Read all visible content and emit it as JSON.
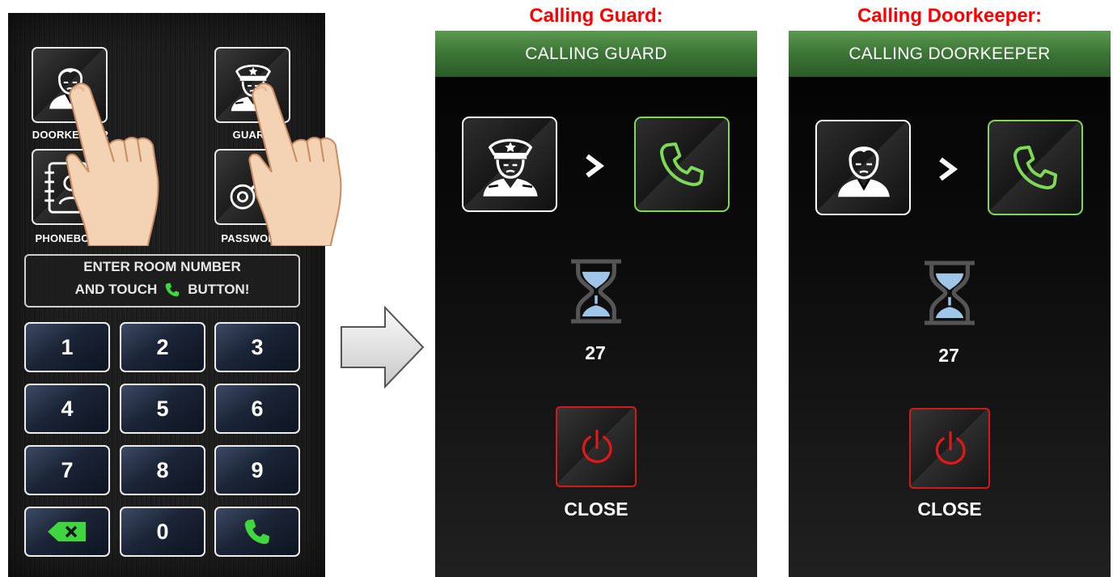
{
  "keypad_screen": {
    "tiles": {
      "doorkeeper": "DOORKEEPER",
      "guard": "GUARD",
      "phonebook": "PHONEBOOK",
      "password": "PASSWORD"
    },
    "instruction": {
      "line1": "ENTER ROOM NUMBER",
      "line2_before": "AND TOUCH",
      "line2_after": "BUTTON!"
    },
    "keys": [
      "1",
      "2",
      "3",
      "4",
      "5",
      "6",
      "7",
      "8",
      "9",
      "0"
    ],
    "icons": {
      "delete": "backspace-icon",
      "call": "phone-icon",
      "hand": "pointing-hand-icon"
    },
    "colors": {
      "accent_green": "#3fd63f",
      "key_border": "#eeeeee"
    }
  },
  "guard_call": {
    "panel_title": "Calling Guard:",
    "header": "CALLING GUARD",
    "countdown": "27",
    "close_label": "CLOSE",
    "icons": {
      "caller": "guard-icon",
      "call": "phone-icon",
      "timer": "hourglass-icon",
      "close": "power-icon"
    }
  },
  "doorkeeper_call": {
    "panel_title": "Calling Doorkeeper:",
    "header": "CALLING DOORKEEPER",
    "countdown": "27",
    "close_label": "CLOSE",
    "icons": {
      "caller": "doorkeeper-icon",
      "call": "phone-icon",
      "timer": "hourglass-icon",
      "close": "power-icon"
    }
  },
  "colors": {
    "title_red": "#ff0000",
    "header_green": "#3c7436",
    "call_green": "#7ed957",
    "close_red": "#d21a1a",
    "hourglass_blue": "#9fc6e8"
  }
}
